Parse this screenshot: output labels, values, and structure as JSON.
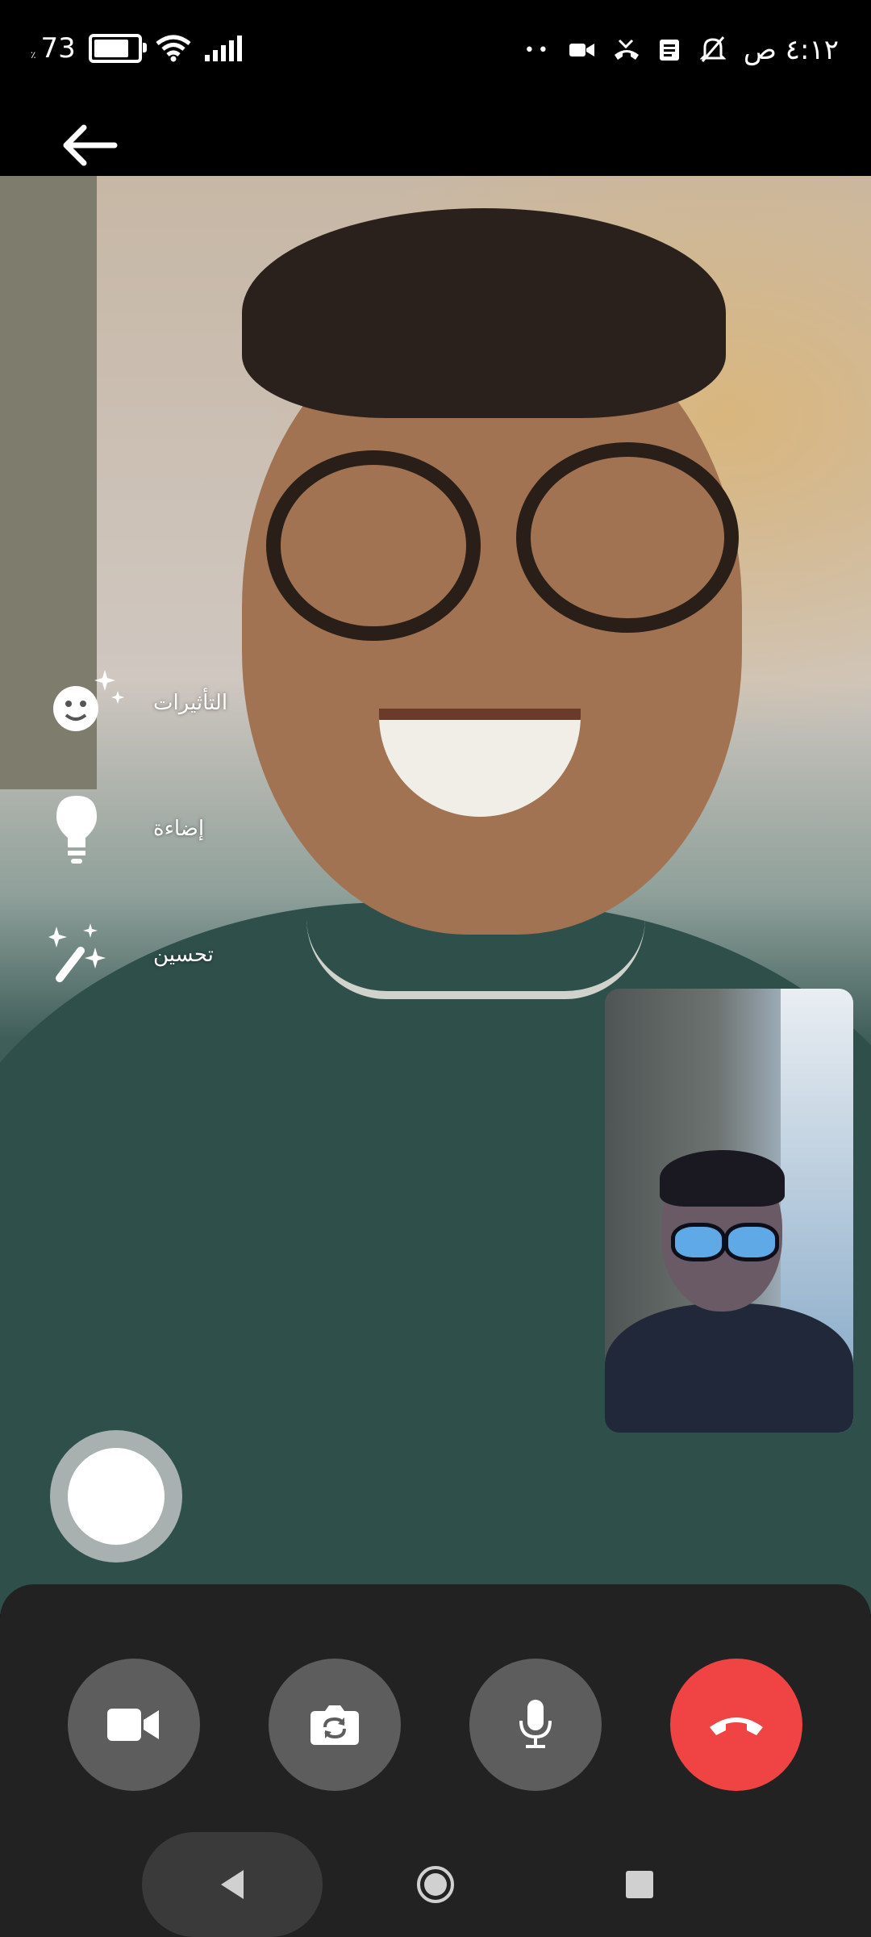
{
  "status_bar": {
    "battery_percent_sign": "٪",
    "battery_level": "73",
    "time": "٤:١٢ ص",
    "dots": "••",
    "icons": [
      "battery-icon",
      "wifi-icon",
      "signal-icon",
      "video-icon",
      "missed-call-icon",
      "news-icon",
      "mute-bell-icon"
    ]
  },
  "header": {
    "back_icon": "arrow-back-icon"
  },
  "effects_menu": [
    {
      "label": "التأثيرات",
      "icon": "face-sparkle-icon"
    },
    {
      "label": "إضاءة",
      "icon": "lightbulb-icon"
    },
    {
      "label": "تحسين",
      "icon": "magic-wand-icon"
    }
  ],
  "controls": {
    "camera_toggle": "video-camera-icon",
    "switch_camera": "camera-switch-icon",
    "microphone": "microphone-icon",
    "end_call": "end-call-icon",
    "end_call_color": "#f04444"
  },
  "navigation": [
    "nav-back-icon",
    "nav-home-icon",
    "nav-recent-icon"
  ]
}
